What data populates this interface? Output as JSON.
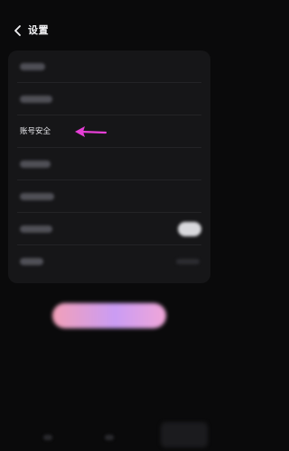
{
  "header": {
    "back_icon": "chevron-left-icon",
    "title": "设置"
  },
  "settings": {
    "items": [
      {
        "label": "",
        "blurred": true,
        "control": "none"
      },
      {
        "label": "",
        "blurred": true,
        "control": "none"
      },
      {
        "label": "账号安全",
        "blurred": false,
        "control": "none"
      },
      {
        "label": "",
        "blurred": true,
        "control": "none"
      },
      {
        "label": "",
        "blurred": true,
        "control": "none"
      },
      {
        "label": "",
        "blurred": true,
        "control": "toggle"
      },
      {
        "label": "",
        "blurred": true,
        "control": "value"
      }
    ]
  },
  "annotation": {
    "icon": "arrow-left-icon",
    "color": "#e63fd6"
  },
  "theme": {
    "background": "#0a0a0b",
    "card": "#161618",
    "cta_gradient": [
      "#f2a0b8",
      "#ca9cf4",
      "#f0a6d8"
    ]
  }
}
